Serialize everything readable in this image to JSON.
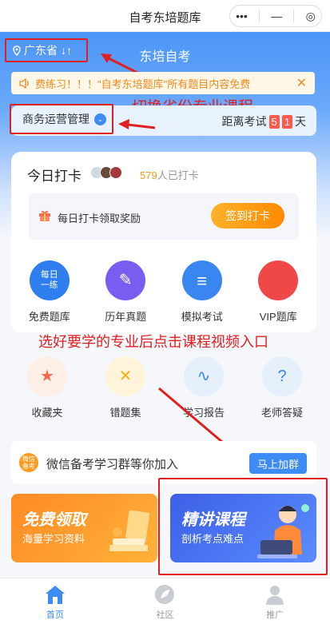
{
  "window": {
    "title": "自考东培题库",
    "capsule_more": "•••",
    "capsule_min": "—",
    "capsule_close": "◎"
  },
  "header": {
    "province": "广东省",
    "province_switch": "↓↑",
    "app_title": "东培自考"
  },
  "notice": {
    "text": "费练习！！！\"自考东培题库\"所有题目内容免费",
    "close": "✕"
  },
  "annotations": {
    "switch": "切换省份专业课程",
    "choose": "选好要学的专业后点击课程视频入口"
  },
  "major": {
    "label": "商务运营管理",
    "chevron": "⌄"
  },
  "exam": {
    "prefix": "距离考试",
    "d1": "5",
    "d2": "1",
    "suffix": "天"
  },
  "checkin": {
    "title": "今日打卡",
    "count": "579",
    "count_suffix": "人已打卡",
    "reward_label": "每日打卡领取奖励",
    "button": "签到打卡"
  },
  "top_icons": [
    {
      "label": "免费题库",
      "icon": "daily-practice-icon",
      "glyph": "每日\n一练",
      "color": "#2f7ef0"
    },
    {
      "label": "历年真题",
      "icon": "exam-paper-icon",
      "glyph": "✎",
      "color": "#7a5cf0"
    },
    {
      "label": "模拟考试",
      "icon": "mock-exam-icon",
      "glyph": "≡",
      "color": "#3a86f0"
    },
    {
      "label": "VIP题库",
      "icon": "vip-icon",
      "glyph": "",
      "color": "#f04848"
    }
  ],
  "bottom_icons": [
    {
      "label": "收藏夹",
      "icon": "favorites-icon",
      "glyph": "★",
      "bg": "#fdeee6",
      "fg": "#f06a4a"
    },
    {
      "label": "错题集",
      "icon": "mistakes-icon",
      "glyph": "✕",
      "bg": "#fff4d9",
      "fg": "#f2b21e"
    },
    {
      "label": "学习报告",
      "icon": "report-icon",
      "glyph": "∿",
      "bg": "#e6f0fd",
      "fg": "#3a86f0"
    },
    {
      "label": "老师答疑",
      "icon": "qa-icon",
      "glyph": "?",
      "bg": "#e6f0fd",
      "fg": "#3a86f0"
    }
  ],
  "group": {
    "badge": "微信\n备考",
    "label": "微信备考学习群等你加入",
    "button": "马上加群"
  },
  "banners": {
    "left": {
      "title": "免费领取",
      "sub": "海量学习资料"
    },
    "right": {
      "title": "精讲课程",
      "sub": "剖析考点难点"
    }
  },
  "tabs": [
    {
      "label": "首页",
      "icon": "home-icon",
      "active": true
    },
    {
      "label": "社区",
      "icon": "community-icon",
      "active": false
    },
    {
      "label": "推广",
      "icon": "user-icon",
      "active": false
    }
  ]
}
